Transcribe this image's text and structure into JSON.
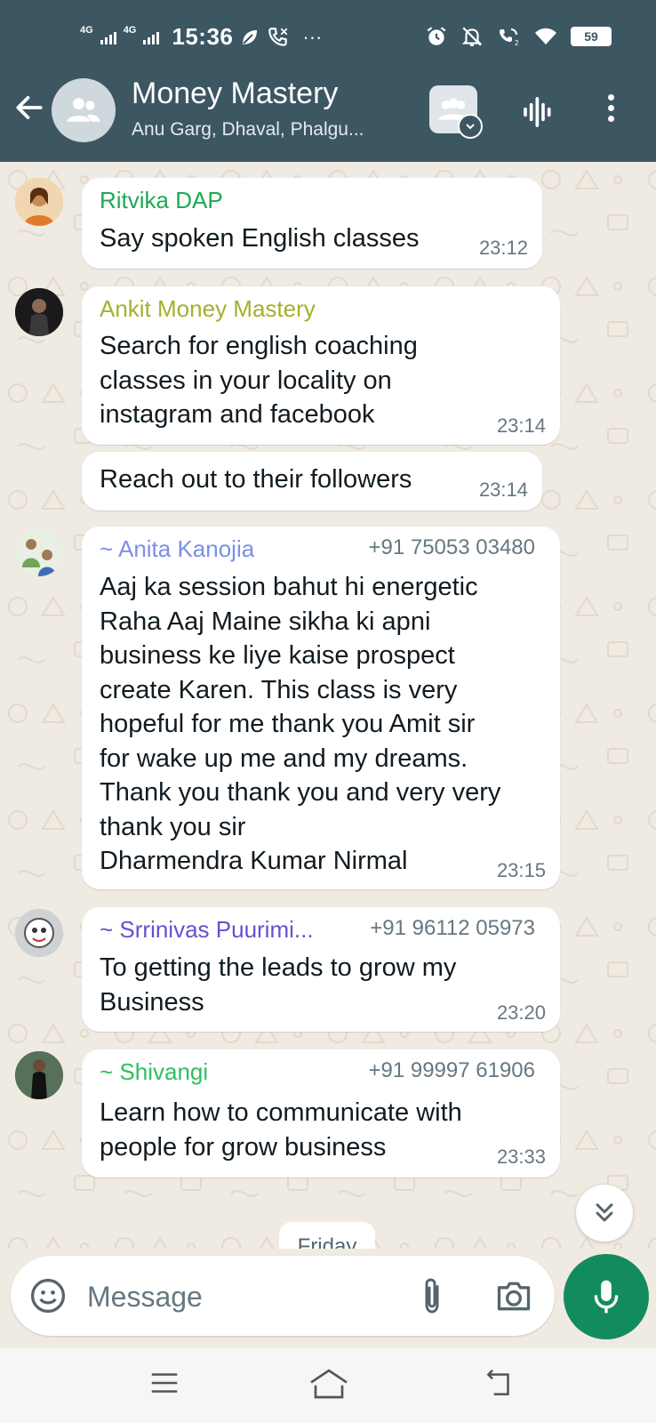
{
  "status_bar": {
    "network_1": "4G",
    "network_2": "4G",
    "time": "15:36",
    "more": "···",
    "battery": "59"
  },
  "header": {
    "title": "Money Mastery",
    "subtitle": "Anu Garg, Dhaval, Phalgu..."
  },
  "messages": [
    {
      "sender": "Ritvika DAP",
      "sender_color": "#1fa855",
      "phone": "",
      "text": "Say spoken English classes",
      "time": "23:12"
    },
    {
      "sender": "Ankit Money Mastery",
      "sender_color": "#a3b02c",
      "phone": "",
      "text": "Search for english coaching\nclasses in your locality on\ninstagram and facebook",
      "time": "23:14"
    },
    {
      "sender": "",
      "phone": "",
      "text": "Reach out to their followers",
      "time": "23:14"
    },
    {
      "sender": "~ Anita Kanojia",
      "sender_color": "#7b8fe6",
      "phone": "+91 75053 03480",
      "text": "Aaj ka session bahut hi energetic\nRaha Aaj Maine sikha ki apni\nbusiness ke liye kaise prospect\ncreate Karen. This class is very\nhopeful for me thank you Amit sir\nfor wake up me and my dreams.\nThank you thank you and very very\nthank you sir\nDharmendra Kumar Nirmal",
      "time": "23:15"
    },
    {
      "sender": "~ Srrinivas Puurimi...",
      "sender_color": "#6b4fd0",
      "phone": "+91 96112 05973",
      "text": "To getting the leads to grow my\nBusiness",
      "time": "23:20"
    },
    {
      "sender": "~ Shivangi",
      "sender_color": "#2fbf5f",
      "phone": "+91 99997 61906",
      "text": "Learn how to communicate with\npeople for grow business",
      "time": "23:33"
    }
  ],
  "date_chip": "Friday",
  "composer": {
    "placeholder": "Message"
  },
  "colors": {
    "header_bg": "#3c5662",
    "chat_bg": "#efeae2",
    "accent_green": "#128c5e"
  },
  "icons": {
    "back": "arrow-left-icon",
    "group": "group-icon",
    "community": "community-icon",
    "voice_call": "audio-wave-icon",
    "menu": "more-vert-icon",
    "emoji": "emoji-icon",
    "attach": "paperclip-icon",
    "camera": "camera-icon",
    "mic": "mic-icon",
    "scroll": "double-chevron-down-icon"
  }
}
